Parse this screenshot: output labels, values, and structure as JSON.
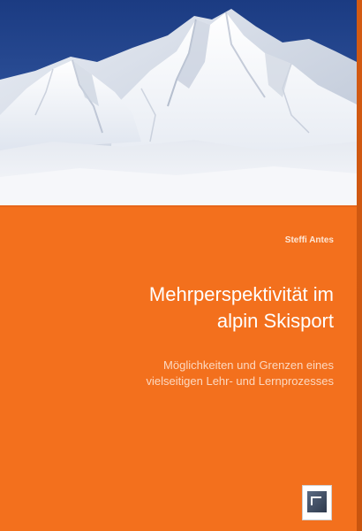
{
  "book": {
    "author": "Steffi Antes",
    "title_line1": "Mehrperspektivität im",
    "title_line2": "alpin Skisport",
    "subtitle_line1": "Möglichkeiten und Grenzen eines",
    "subtitle_line2": "vielseitigen Lehr- und Lernprozesses"
  },
  "colors": {
    "cover_background": "#f3701d",
    "sky": "#1d3f86",
    "snow": "#f2f4f8",
    "title_text": "#ffffff",
    "subtitle_text": "#fcd8c0"
  },
  "icons": {
    "publisher_logo": "publisher-logo-icon",
    "photo": "snowy-mountains-photo"
  }
}
